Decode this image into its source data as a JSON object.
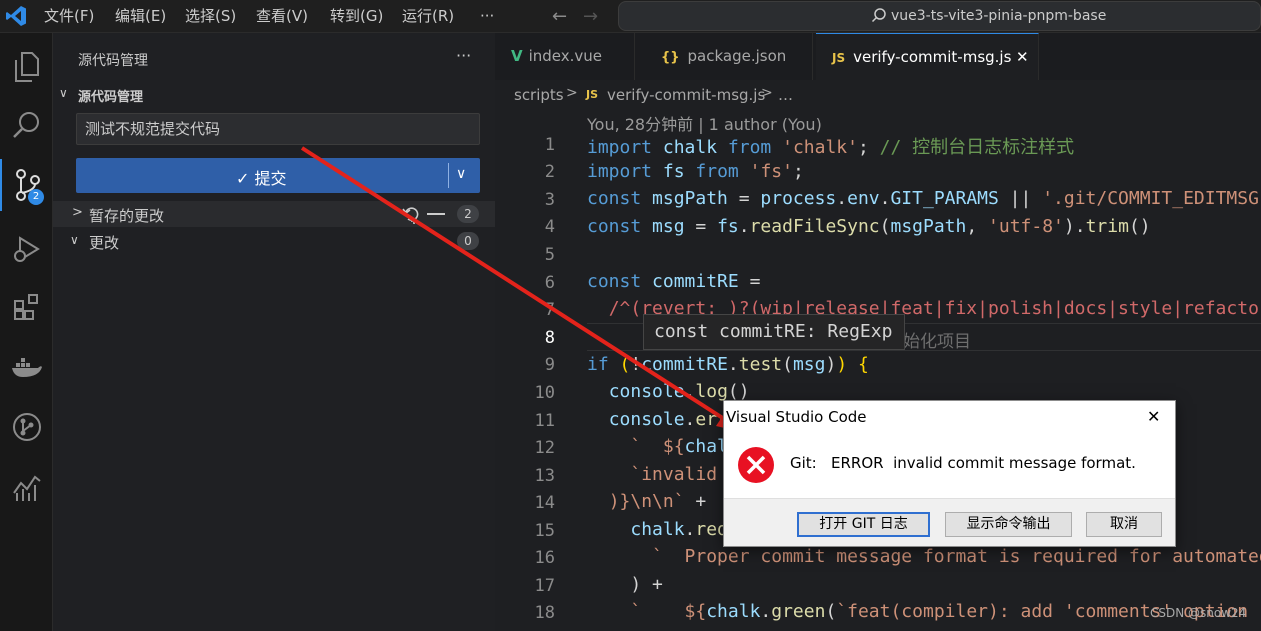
{
  "menu": {
    "items": [
      "文件(F)",
      "编辑(E)",
      "选择(S)",
      "查看(V)",
      "转到(G)",
      "运行(R)"
    ],
    "more": "···",
    "search_text": "vue3-ts-vite3-pinia-pnpm-base"
  },
  "activity": {
    "scm_badge": "2"
  },
  "sidebar": {
    "title": "源代码管理",
    "more": "···",
    "section_label": "源代码管理",
    "commit_message": "测试不规范提交代码",
    "commit_button": "✓ 提交",
    "staged": {
      "label": "暂存的更改",
      "count": "2"
    },
    "changes": {
      "label": "更改",
      "count": "0"
    }
  },
  "tabs": [
    {
      "label": "index.vue",
      "icon": "V"
    },
    {
      "label": "package.json",
      "icon": "{}"
    },
    {
      "label": "verify-commit-msg.js",
      "icon": "JS",
      "close": "✕"
    }
  ],
  "breadcrumb": {
    "folder": "scripts",
    "file": "verify-commit-msg.js",
    "tail": "…",
    "icon": "JS"
  },
  "blame": "You, 28分钟前 | 1 author (You)",
  "line_numbers": [
    "1",
    "2",
    "3",
    "4",
    "5",
    "6",
    "7",
    "8",
    "9",
    "10",
    "11",
    "12",
    "13",
    "14",
    "15",
    "16",
    "17",
    "18"
  ],
  "hover": "const commitRE: RegExp",
  "hover_behind": "始化项目",
  "dialog": {
    "title": "Visual Studio Code",
    "close": "✕",
    "label": "Git:",
    "message": "ERROR  invalid commit message format.",
    "buttons": [
      "打开 GIT 日志",
      "显示命令输出",
      "取消"
    ]
  },
  "watermark": "CSDN @snow24",
  "colors": {
    "commit_button": "#2f5fa8",
    "error_icon": "#e81123",
    "arrow": "#e3231b"
  }
}
